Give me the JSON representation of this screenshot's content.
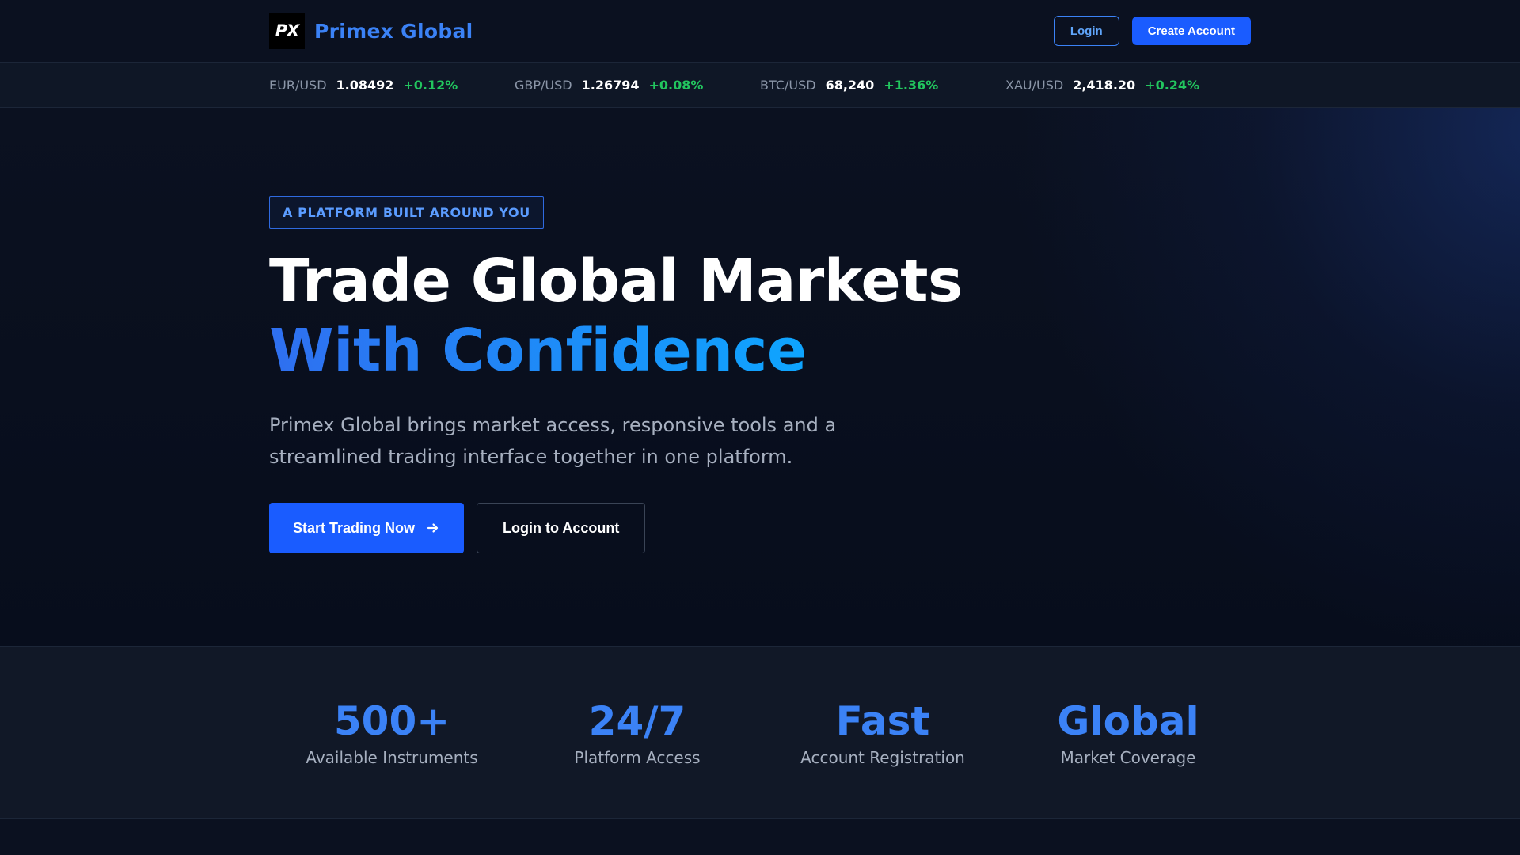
{
  "header": {
    "logo_text": "PX",
    "brand_name": "Primex Global",
    "login_label": "Login",
    "create_account_label": "Create Account"
  },
  "ticker": [
    {
      "symbol": "EUR/USD",
      "price": "1.08492",
      "change": "+0.12%"
    },
    {
      "symbol": "GBP/USD",
      "price": "1.26794",
      "change": "+0.08%"
    },
    {
      "symbol": "BTC/USD",
      "price": "68,240",
      "change": "+1.36%"
    },
    {
      "symbol": "XAU/USD",
      "price": "2,418.20",
      "change": "+0.24%"
    }
  ],
  "hero": {
    "badge": "A PLATFORM BUILT AROUND YOU",
    "headline_line1": "Trade Global Markets",
    "headline_line2": "With Confidence",
    "description": "Primex Global brings market access, responsive tools and a streamlined trading interface together in one platform.",
    "primary_cta": "Start Trading Now",
    "secondary_cta": "Login to Account"
  },
  "stats": [
    {
      "value": "500+",
      "label": "Available Instruments"
    },
    {
      "value": "24/7",
      "label": "Platform Access"
    },
    {
      "value": "Fast",
      "label": "Account Registration"
    },
    {
      "value": "Global",
      "label": "Market Coverage"
    }
  ],
  "colors": {
    "accent": "#1a5cff",
    "brand": "#3b82f6",
    "positive": "#22c55e",
    "background": "#0b1120"
  }
}
